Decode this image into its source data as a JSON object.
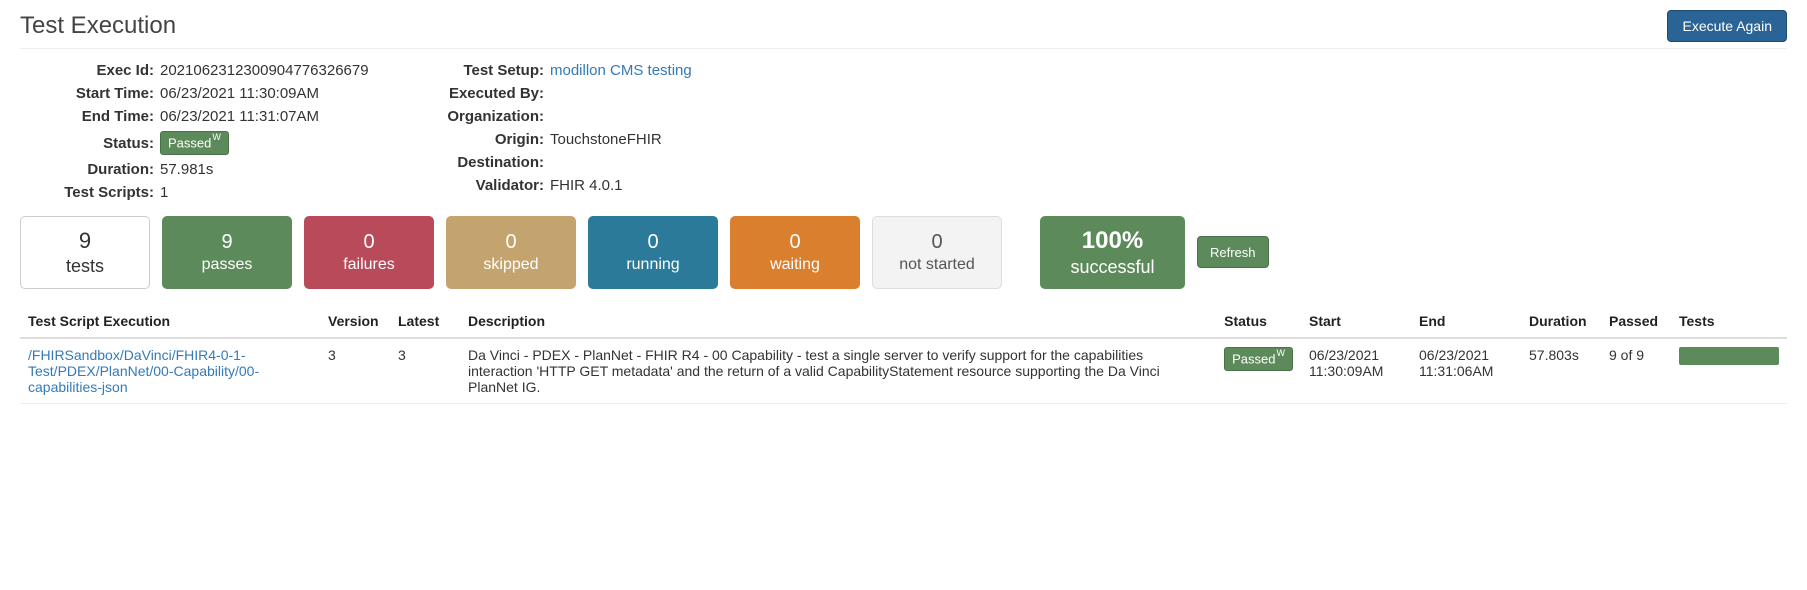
{
  "header": {
    "title": "Test Execution",
    "execute_again_label": "Execute Again"
  },
  "meta_left": {
    "exec_id_label": "Exec Id:",
    "exec_id": "2021062312300904776326679",
    "start_time_label": "Start Time:",
    "start_time": "06/23/2021 11:30:09AM",
    "end_time_label": "End Time:",
    "end_time": "06/23/2021 11:31:07AM",
    "status_label": "Status:",
    "status_badge": "Passed",
    "status_badge_sup": "W",
    "duration_label": "Duration:",
    "duration": "57.981s",
    "test_scripts_label": "Test Scripts:",
    "test_scripts": "1"
  },
  "meta_right": {
    "test_setup_label": "Test Setup:",
    "test_setup": "modillon CMS testing",
    "executed_by_label": "Executed By:",
    "executed_by": "",
    "organization_label": "Organization:",
    "organization": "",
    "origin_label": "Origin:",
    "origin": "TouchstoneFHIR",
    "destination_label": "Destination:",
    "destination": "",
    "validator_label": "Validator:",
    "validator": "FHIR 4.0.1"
  },
  "counters": {
    "tests": {
      "value": "9",
      "label": "tests"
    },
    "passes": {
      "value": "9",
      "label": "passes"
    },
    "failures": {
      "value": "0",
      "label": "failures"
    },
    "skipped": {
      "value": "0",
      "label": "skipped"
    },
    "running": {
      "value": "0",
      "label": "running"
    },
    "waiting": {
      "value": "0",
      "label": "waiting"
    },
    "not_started": {
      "value": "0",
      "label": "not started"
    },
    "success": {
      "value": "100%",
      "label": "successful"
    },
    "refresh_label": "Refresh"
  },
  "table": {
    "headers": {
      "script": "Test Script Execution",
      "version": "Version",
      "latest": "Latest",
      "description": "Description",
      "status": "Status",
      "start": "Start",
      "end": "End",
      "duration": "Duration",
      "passed": "Passed",
      "tests": "Tests"
    },
    "rows": [
      {
        "script": "/FHIRSandbox/DaVinci/FHIR4-0-1-Test/PDEX/PlanNet/00-Capability/00-capabilities-json",
        "version": "3",
        "latest": "3",
        "description": "Da Vinci - PDEX - PlanNet - FHIR R4 - 00 Capability - test a single server to verify support for the capabilities interaction 'HTTP GET metadata' and the return of a valid CapabilityStatement resource supporting the Da Vinci PlanNet IG.",
        "status": "Passed",
        "status_sup": "W",
        "start": "06/23/2021 11:30:09AM",
        "end": "06/23/2021 11:31:06AM",
        "duration": "57.803s",
        "passed": "9 of 9"
      }
    ]
  }
}
